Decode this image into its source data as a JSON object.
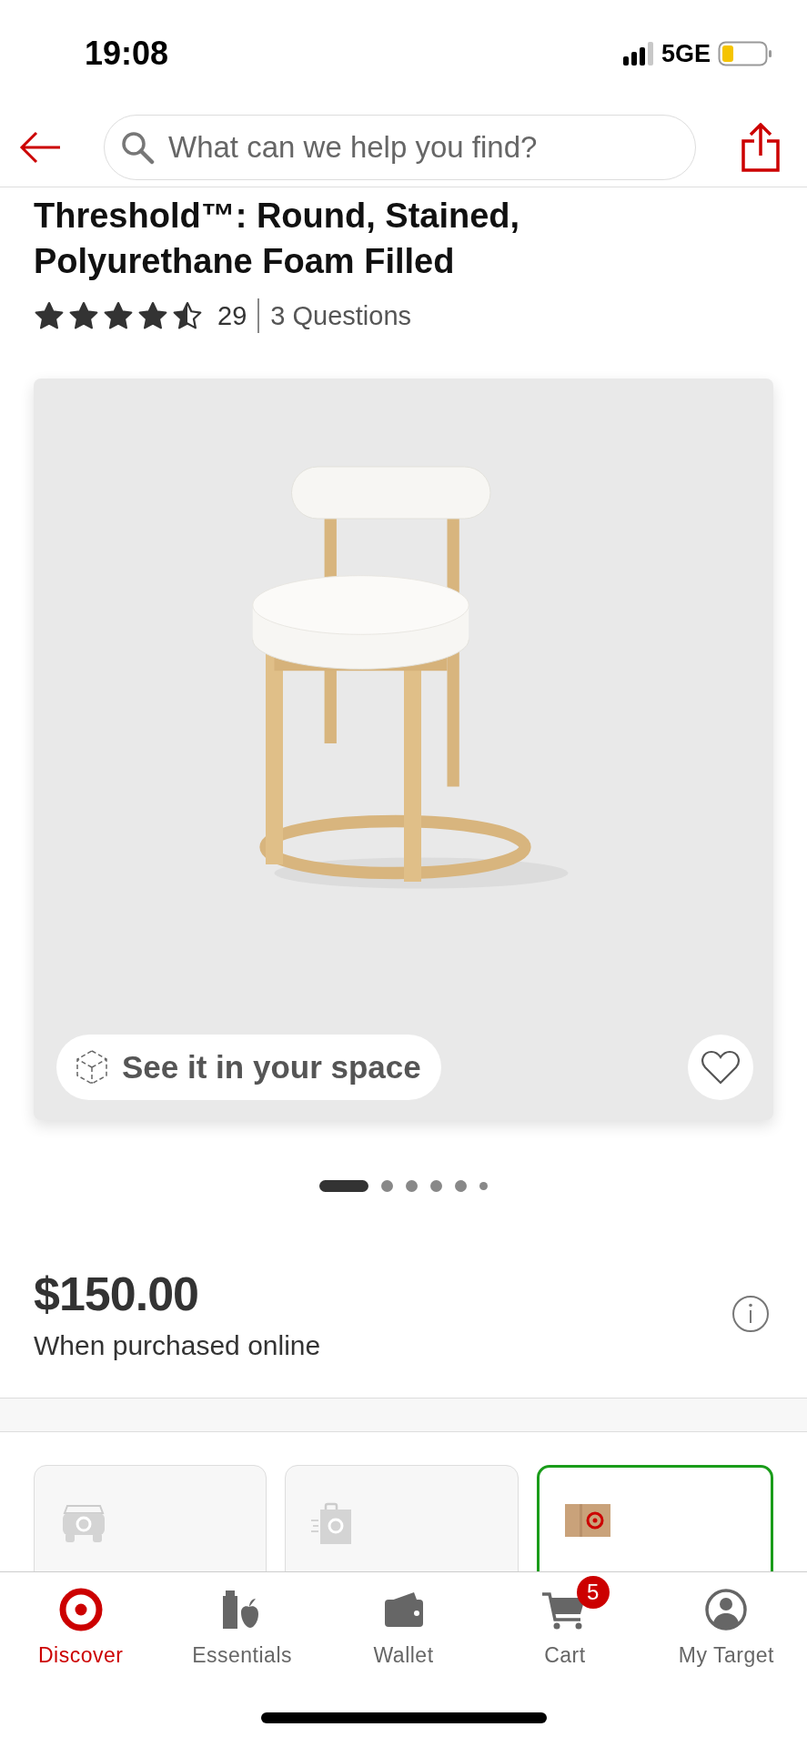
{
  "status_bar": {
    "time": "19:08",
    "network": "5GE"
  },
  "search": {
    "placeholder": "What can we help you find?"
  },
  "product": {
    "title": "Threshold™: Round, Stained, Polyurethane Foam Filled",
    "stars": 4.5,
    "review_count": "29",
    "questions": "3 Questions"
  },
  "gallery": {
    "ar_button": "See it in your space",
    "favorite": false,
    "dots": [
      {
        "selected": true
      },
      {
        "selected": false
      },
      {
        "selected": false
      },
      {
        "selected": false
      },
      {
        "selected": false
      },
      {
        "selected": false
      }
    ]
  },
  "price": {
    "amount": "$150.00",
    "note": "When purchased online"
  },
  "fulfillment": [
    {
      "kind": "pickup",
      "selected": false
    },
    {
      "kind": "delivery",
      "selected": false
    },
    {
      "kind": "shipping",
      "selected": true
    }
  ],
  "tab_bar": [
    {
      "kind": "discover",
      "label": "Discover",
      "selected": true
    },
    {
      "kind": "essentials",
      "label": "Essentials",
      "selected": false
    },
    {
      "kind": "wallet",
      "label": "Wallet",
      "selected": false
    },
    {
      "kind": "cart",
      "label": "Cart",
      "selected": false,
      "badge": "5"
    },
    {
      "kind": "account",
      "label": "My Target",
      "selected": false
    }
  ]
}
